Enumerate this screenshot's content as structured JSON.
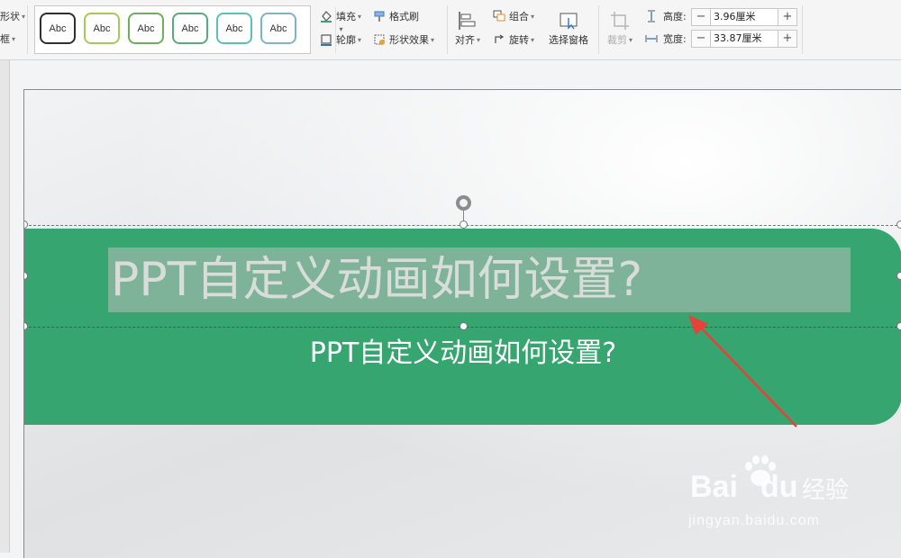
{
  "ribbon": {
    "left_partial": {
      "shape": "形状",
      "edit": "框"
    },
    "style_presets": [
      {
        "label": "Abc",
        "border": "#2f2f2f"
      },
      {
        "label": "Abc",
        "border": "#a7c957"
      },
      {
        "label": "Abc",
        "border": "#6fae5b"
      },
      {
        "label": "Abc",
        "border": "#5aaa7e"
      },
      {
        "label": "Abc",
        "border": "#5bc0b8"
      },
      {
        "label": "Abc",
        "border": "#7fb4c8"
      }
    ],
    "fill_label": "填充",
    "outline_label": "轮廓",
    "format_painter_label": "格式刷",
    "shape_effects_label": "形状效果",
    "align_label": "对齐",
    "group_label": "组合",
    "rotate_label": "旋转",
    "selection_pane_label": "选择窗格",
    "crop_label": "裁剪",
    "height_label": "高度:",
    "height_value": "3.96厘米",
    "width_label": "宽度:",
    "width_value": "33.87厘米"
  },
  "slide": {
    "title": "PPT自定义动画如何设置?",
    "subtitle": "PPT自定义动画如何设置?",
    "banner_color": "#36a56f"
  },
  "watermark": {
    "brand": "Bai",
    "brand2": "du",
    "product": "经验",
    "url": "jingyan.baidu.com"
  }
}
